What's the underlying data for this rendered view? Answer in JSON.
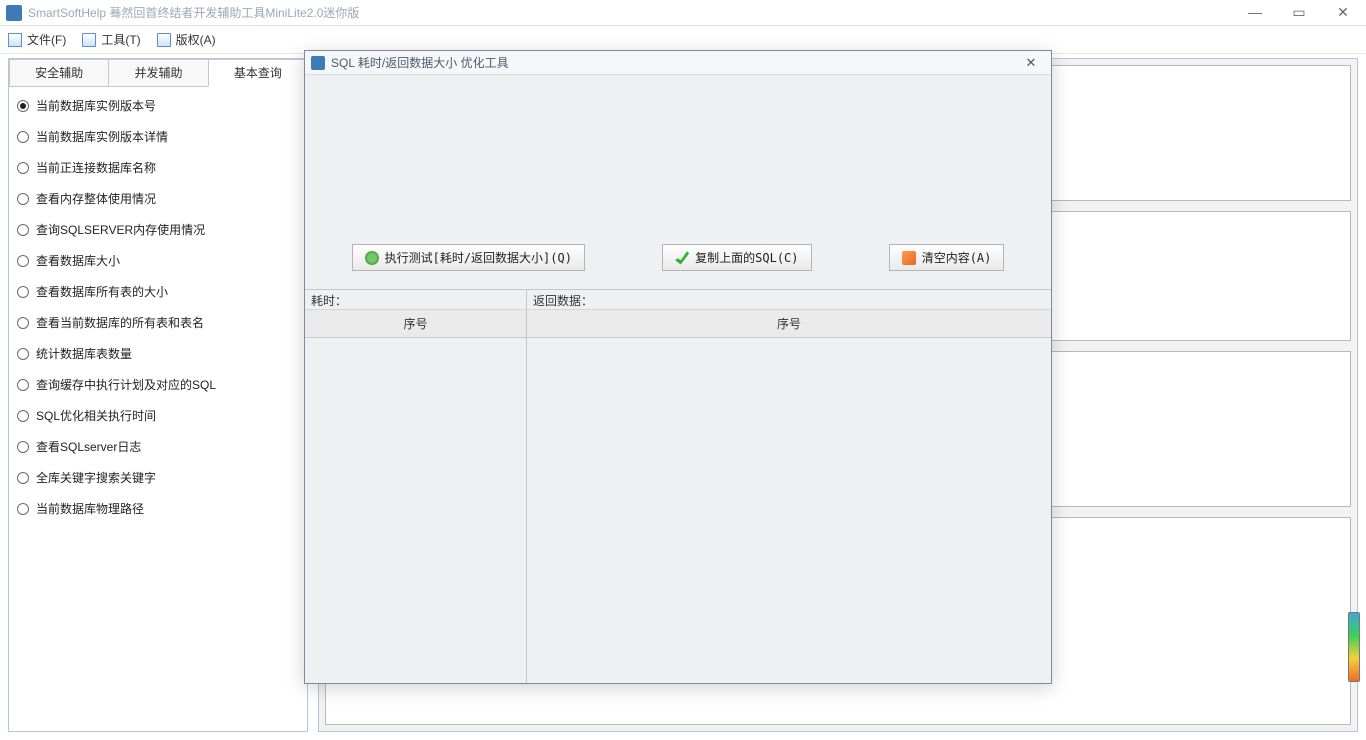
{
  "titlebar": {
    "title": "SmartSoftHelp 蓦然回首终结者开发辅助工具MiniLite2.0迷你版"
  },
  "menus": {
    "file": "文件(F)",
    "tools": "工具(T)",
    "copyright": "版权(A)"
  },
  "tabs": {
    "security": "安全辅助",
    "concurrency": "并发辅助",
    "basic_query": "基本查询"
  },
  "radios": [
    "当前数据库实例版本号",
    "当前数据库实例版本详情",
    "当前正连接数据库名称",
    "查看内存整体使用情况",
    "查询SQLSERVER内存使用情况",
    "查看数据库大小",
    "查看数据库所有表的大小",
    "查看当前数据库的所有表和表名",
    "统计数据库表数量",
    "查询缓存中执行计划及对应的SQL",
    "SQL优化相关执行时间",
    "查看SQLserver日志",
    "全库关键字搜索关键字",
    "当前数据库物理路径"
  ],
  "dialog": {
    "title": "SQL 耗时/返回数据大小 优化工具",
    "buttons": {
      "run": "执行测试[耗时/返回数据大小](Q)",
      "copy": "复制上面的SQL(C)",
      "clear": "清空内容(A)"
    },
    "col_left_title": "耗时：",
    "col_right_title": "返回数据：",
    "grid_header_left": "序号",
    "grid_header_right": "序号"
  }
}
